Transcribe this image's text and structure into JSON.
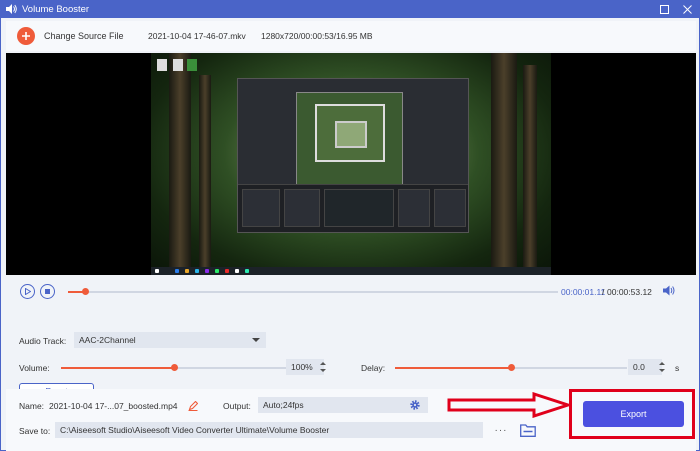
{
  "window": {
    "title": "Volume Booster"
  },
  "source": {
    "change_label": "Change Source File",
    "file_name": "2021-10-04 17-46-07.mkv",
    "meta": "1280x720/00:00:53/16.95 MB"
  },
  "playback": {
    "current_time": "00:00:01.11",
    "separator": "/",
    "total_time": "00:00:53.12",
    "progress": 0.035
  },
  "audio": {
    "track_label": "Audio Track:",
    "track_value": "AAC-2Channel",
    "volume_label": "Volume:",
    "volume_value": "100%",
    "volume_level": 0.5,
    "delay_label": "Delay:",
    "delay_value": "0.0",
    "delay_unit": "s",
    "delay_level": 0.5,
    "reset_label": "Reset"
  },
  "output": {
    "name_label": "Name:",
    "name_value": "2021-10-04 17-...07_boosted.mp4",
    "output_label": "Output:",
    "output_value": "Auto;24fps",
    "save_label": "Save to:",
    "save_path": "C:\\Aiseesoft Studio\\Aiseesoft Video Converter Ultimate\\Volume Booster",
    "more_label": "···",
    "export_label": "Export"
  },
  "colors": {
    "accent": "#4a64c8",
    "slider": "#ef5b3a",
    "export": "#4b50e0",
    "highlight": "#e0001b"
  }
}
